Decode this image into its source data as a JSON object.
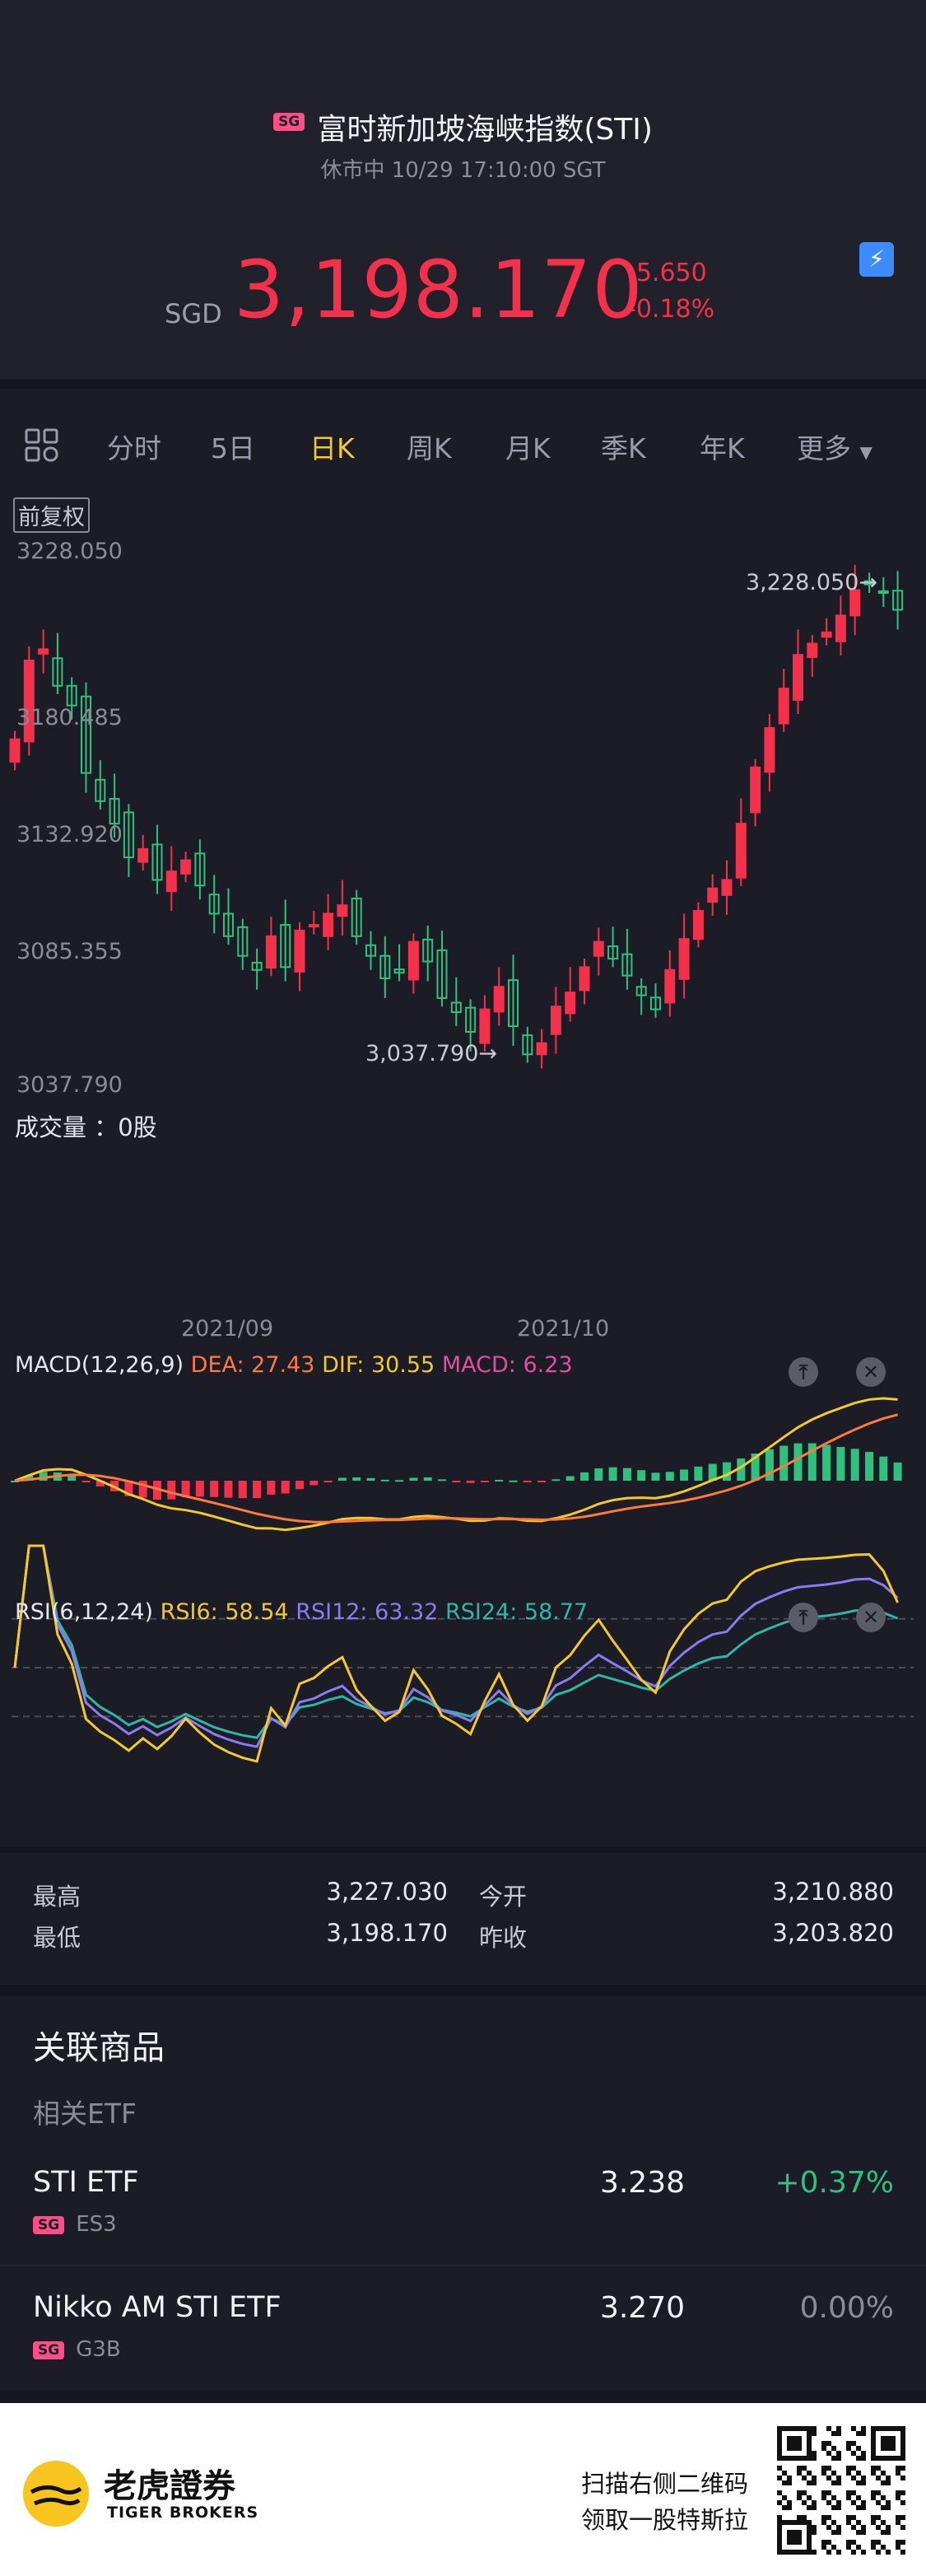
{
  "header": {
    "market_badge": "SG",
    "title": "富时新加坡海峡指数(STI)",
    "status": "休市中 10/29 17:10:00 SGT",
    "currency": "SGD",
    "price": "3,198.170",
    "change": "-5.650",
    "change_pct": "-0.18%",
    "flash_icon": "lightning-icon"
  },
  "tabs": {
    "items": [
      "分时",
      "5日",
      "日K",
      "周K",
      "月K",
      "季K",
      "年K",
      "更多"
    ],
    "active": "日K"
  },
  "chart": {
    "adjust_label": "前复权",
    "price_axis": [
      "3228.050",
      "3180.485",
      "3132.920",
      "3085.355",
      "3037.790"
    ],
    "high_marker": "3,228.050",
    "low_marker": "3,037.790",
    "volume_label": "成交量 ：0股",
    "date_labels": [
      "2021/09",
      "2021/10"
    ],
    "macd": {
      "label": "MACD(12,26,9)",
      "dea": "DEA: 27.43",
      "dif": "DIF: 30.55",
      "macd": "MACD: 6.23"
    },
    "rsi": {
      "label": "RSI(6,12,24)",
      "rsi6": "RSI6: 58.54",
      "rsi12": "RSI12: 63.32",
      "rsi24": "RSI24: 58.77"
    },
    "colors": {
      "up": "#f5304a",
      "down": "#2ec27e",
      "yellow": "#f3c92b",
      "orange": "#ff7a3d",
      "purple": "#8a7cf0",
      "teal": "#2eb7a6"
    }
  },
  "chart_data": {
    "type": "candlestick",
    "x_labels": [
      "2021/09",
      "2021/10"
    ],
    "ylim": [
      3037.79,
      3228.05
    ],
    "close_series": [
      3162,
      3190,
      3194,
      3181,
      3174,
      3150,
      3140,
      3132,
      3120,
      3123,
      3112,
      3115,
      3119,
      3110,
      3100,
      3092,
      3085,
      3080,
      3092,
      3081,
      3094,
      3096,
      3100,
      3103,
      3092,
      3085,
      3077,
      3079,
      3090,
      3083,
      3070,
      3065,
      3058,
      3066,
      3074,
      3060,
      3050,
      3054,
      3067,
      3072,
      3081,
      3090,
      3084,
      3078,
      3071,
      3066,
      3080,
      3091,
      3101,
      3109,
      3112,
      3132,
      3152,
      3166,
      3180,
      3192,
      3196,
      3200,
      3206,
      3215,
      3217,
      3214,
      3208
    ]
  },
  "stats": {
    "high_label": "最高",
    "high": "3,227.030",
    "low_label": "最低",
    "low": "3,198.170",
    "open_label": "今开",
    "open": "3,210.880",
    "prev_label": "昨收",
    "prev": "3,203.820"
  },
  "related": {
    "title": "关联商品",
    "subtitle": "相关ETF",
    "items": [
      {
        "name": "STI ETF",
        "badge": "SG",
        "code": "ES3",
        "price": "3.238",
        "change": "+0.37%",
        "color": "#2ec27e"
      },
      {
        "name": "Nikko AM STI ETF",
        "badge": "SG",
        "code": "G3B",
        "price": "3.270",
        "change": "0.00%",
        "color": "#8a8c99"
      }
    ]
  },
  "footer": {
    "brand_cn": "老虎證券",
    "brand_en": "TIGER BROKERS",
    "scan_line1": "扫描右侧二维码",
    "scan_line2": "领取一股特斯拉"
  }
}
